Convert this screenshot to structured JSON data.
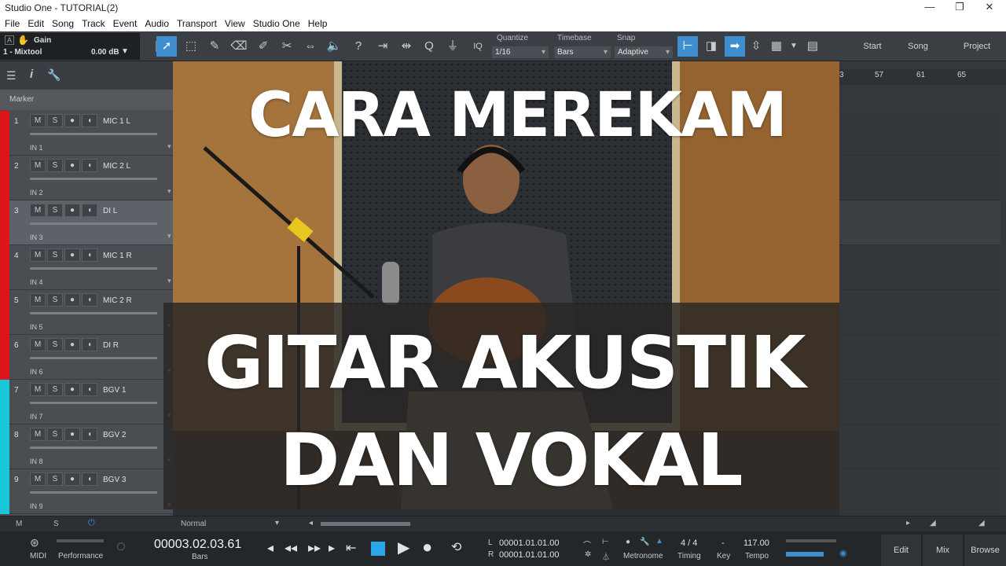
{
  "window": {
    "title": "Studio One - TUTORIAL(2)",
    "minimize": "—",
    "restore": "❐",
    "close": "✕"
  },
  "menu": [
    "File",
    "Edit",
    "Song",
    "Track",
    "Event",
    "Audio",
    "Transport",
    "View",
    "Studio One",
    "Help"
  ],
  "toolbar": {
    "gain_label": "Gain",
    "track_name": "1 - Mixtool",
    "gain_value": "0.00 dB",
    "iq_label": "IQ",
    "quantize_label": "Quantize",
    "quantize_value": "1/16",
    "timebase_label": "Timebase",
    "timebase_value": "Bars",
    "snap_label": "Snap",
    "snap_value": "Adaptive",
    "nav": [
      "Start",
      "Song",
      "Project"
    ]
  },
  "panel": {
    "marker_label": "Marker"
  },
  "tracks": [
    {
      "num": "1",
      "name": "MIC 1 L",
      "input": "IN 1",
      "color": "#e0141b"
    },
    {
      "num": "2",
      "name": "MIC 2 L",
      "input": "IN 2",
      "color": "#e0141b"
    },
    {
      "num": "3",
      "name": "DI L",
      "input": "IN 3",
      "color": "#e0141b"
    },
    {
      "num": "4",
      "name": "MIC 1 R",
      "input": "IN 4",
      "color": "#e0141b"
    },
    {
      "num": "5",
      "name": "MIC 2 R",
      "input": "IN 5",
      "color": "#e0141b"
    },
    {
      "num": "6",
      "name": "DI R",
      "input": "IN 6",
      "color": "#e0141b"
    },
    {
      "num": "7",
      "name": "BGV 1",
      "input": "IN 7",
      "color": "#18c8d8"
    },
    {
      "num": "8",
      "name": "BGV 2",
      "input": "IN 8",
      "color": "#18c8d8"
    },
    {
      "num": "9",
      "name": "BGV 3",
      "input": "IN 9",
      "color": "#18c8d8"
    }
  ],
  "track_buttons": {
    "mute": "M",
    "solo": "S",
    "record": "●",
    "monitor": "◖"
  },
  "ruler": [
    "3",
    "57",
    "61",
    "65"
  ],
  "bottom": {
    "m": "M",
    "s": "S",
    "mode": "Normal"
  },
  "transport": {
    "midi_label": "MIDI",
    "performance_label": "Performance",
    "time": "00003.02.03.61",
    "time_unit": "Bars",
    "loop_l_label": "L",
    "loop_l": "00001.01.01.00",
    "loop_r_label": "R",
    "loop_r": "00001.01.01.00",
    "metronome_label": "Metronome",
    "timing_value": "4 / 4",
    "timing_label": "Timing",
    "key_value": "-",
    "key_label": "Key",
    "tempo_value": "117.00",
    "tempo_label": "Tempo"
  },
  "views": [
    "Edit",
    "Mix",
    "Browse"
  ],
  "overlay": {
    "line1": "CARA MEREKAM",
    "line2": "GITAR AKUSTIK",
    "line3": "DAN VOKAL"
  },
  "colors": {
    "accent": "#3e8ed0",
    "track_red": "#e0141b",
    "track_cyan": "#18c8d8"
  }
}
